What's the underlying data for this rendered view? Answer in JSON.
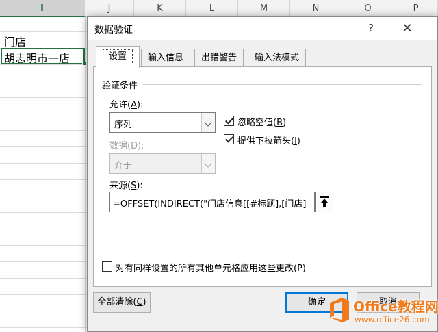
{
  "spreadsheet": {
    "columns": [
      "I",
      "J",
      "K",
      "L",
      "M",
      "N",
      "O",
      "P"
    ],
    "active_column": "I",
    "cells": [
      "门店",
      "胡志明市一店"
    ]
  },
  "dialog": {
    "title": "数据验证",
    "help_label": "?",
    "close_label": "✕",
    "tabs": [
      "设置",
      "输入信息",
      "出错警告",
      "输入法模式"
    ],
    "active_tab": 0,
    "group_title": "验证条件",
    "allow": {
      "label_pre": "允许(",
      "label_key": "A",
      "label_post": "):",
      "value": "序列"
    },
    "data": {
      "label": "数据(D):",
      "value": "介于",
      "disabled": true
    },
    "ignore_blank": {
      "label_pre": "忽略空值(",
      "label_key": "B",
      "label_post": ")",
      "checked": true
    },
    "dropdown": {
      "label_pre": "提供下拉箭头(",
      "label_key": "I",
      "label_post": ")",
      "checked": true
    },
    "source": {
      "label_pre": "来源(",
      "label_key": "S",
      "label_post": "):",
      "value": "=OFFSET(INDIRECT(\"门店信息[[#标题],[门店]"
    },
    "apply_all": {
      "label_pre": "对有同样设置的所有其他单元格应用这些更改(",
      "label_key": "P",
      "label_post": ")",
      "checked": false
    },
    "buttons": {
      "clear_all_pre": "全部清除(",
      "clear_all_key": "C",
      "clear_all_post": ")",
      "ok": "确定",
      "cancel": "取消"
    }
  },
  "watermark": {
    "title": "Office教程网",
    "url": "www.office26.com"
  },
  "colors": {
    "excel_green": "#217346",
    "focus_blue": "#0078d7",
    "watermark_orange": "#f07b1d"
  }
}
